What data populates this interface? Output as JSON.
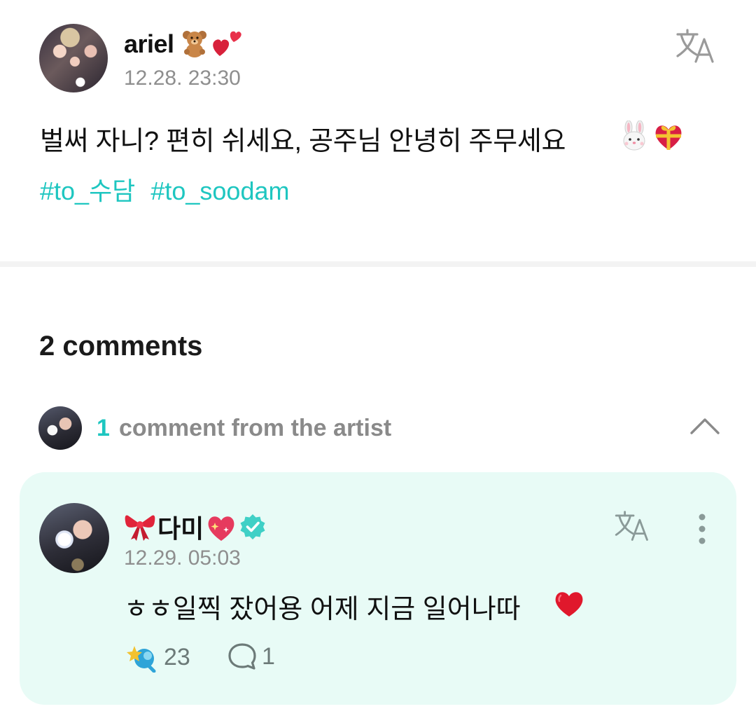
{
  "post": {
    "username": "ariel",
    "username_emojis": [
      "teddy-bear-emoji",
      "two-hearts-emoji"
    ],
    "timestamp": "12.28. 23:30",
    "body": "벌써 자니? 편히 쉬세요, 공주님 안녕히 주무세요",
    "body_emojis": [
      "rabbit-face-emoji",
      "heart-with-ribbon-emoji"
    ],
    "hashtags": [
      "#to_수담",
      "#to_soodam"
    ]
  },
  "comments": {
    "count_label": "2 comments",
    "artist_section": {
      "count": "1",
      "label": "comment from the artist"
    }
  },
  "artist_comment": {
    "name": "다미",
    "name_emojis": [
      "ribbon-emoji",
      "sparkling-heart-emoji"
    ],
    "verified_icon": "verified-badge-icon",
    "timestamp": "12.29. 05:03",
    "body": "ㅎㅎ일찍 잤어용 어제 지금 일어나따",
    "body_emoji": "red-heart-emoji",
    "likes": "23",
    "replies": "1"
  },
  "colors": {
    "accent": "#1ec6c0",
    "card_bg": "#e8fbf6",
    "muted": "#8e8e8e"
  }
}
